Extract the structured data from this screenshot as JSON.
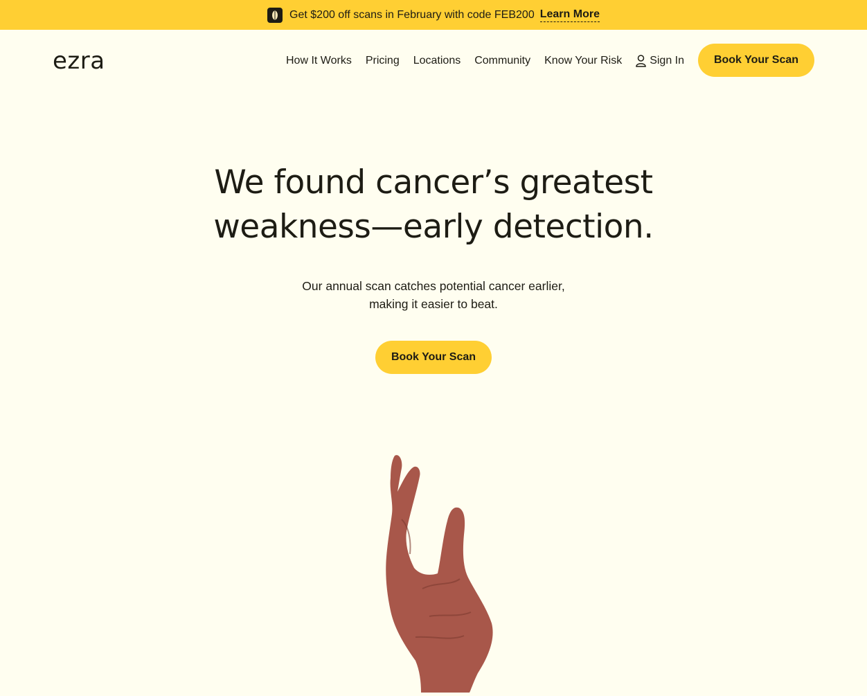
{
  "promo": {
    "text": "Get $200 off scans in February with code FEB200",
    "link_label": "Learn More",
    "icon": "seed-icon"
  },
  "nav": {
    "logo": "ezra",
    "links": [
      "How It Works",
      "Pricing",
      "Locations",
      "Community",
      "Know Your Risk"
    ],
    "sign_in": "Sign In",
    "cta": "Book Your Scan"
  },
  "hero": {
    "title_line1": "We found cancer’s greatest",
    "title_line2": "weakness—early detection.",
    "subtitle_line1": "Our annual scan catches potential cancer earlier,",
    "subtitle_line2": "making it easier to beat.",
    "cta": "Book Your Scan",
    "image": "reaching-hand-image"
  },
  "colors": {
    "background": "#fffef0",
    "accent": "#ffcf33",
    "text": "#1d1c14",
    "hand": "#a8574a"
  }
}
